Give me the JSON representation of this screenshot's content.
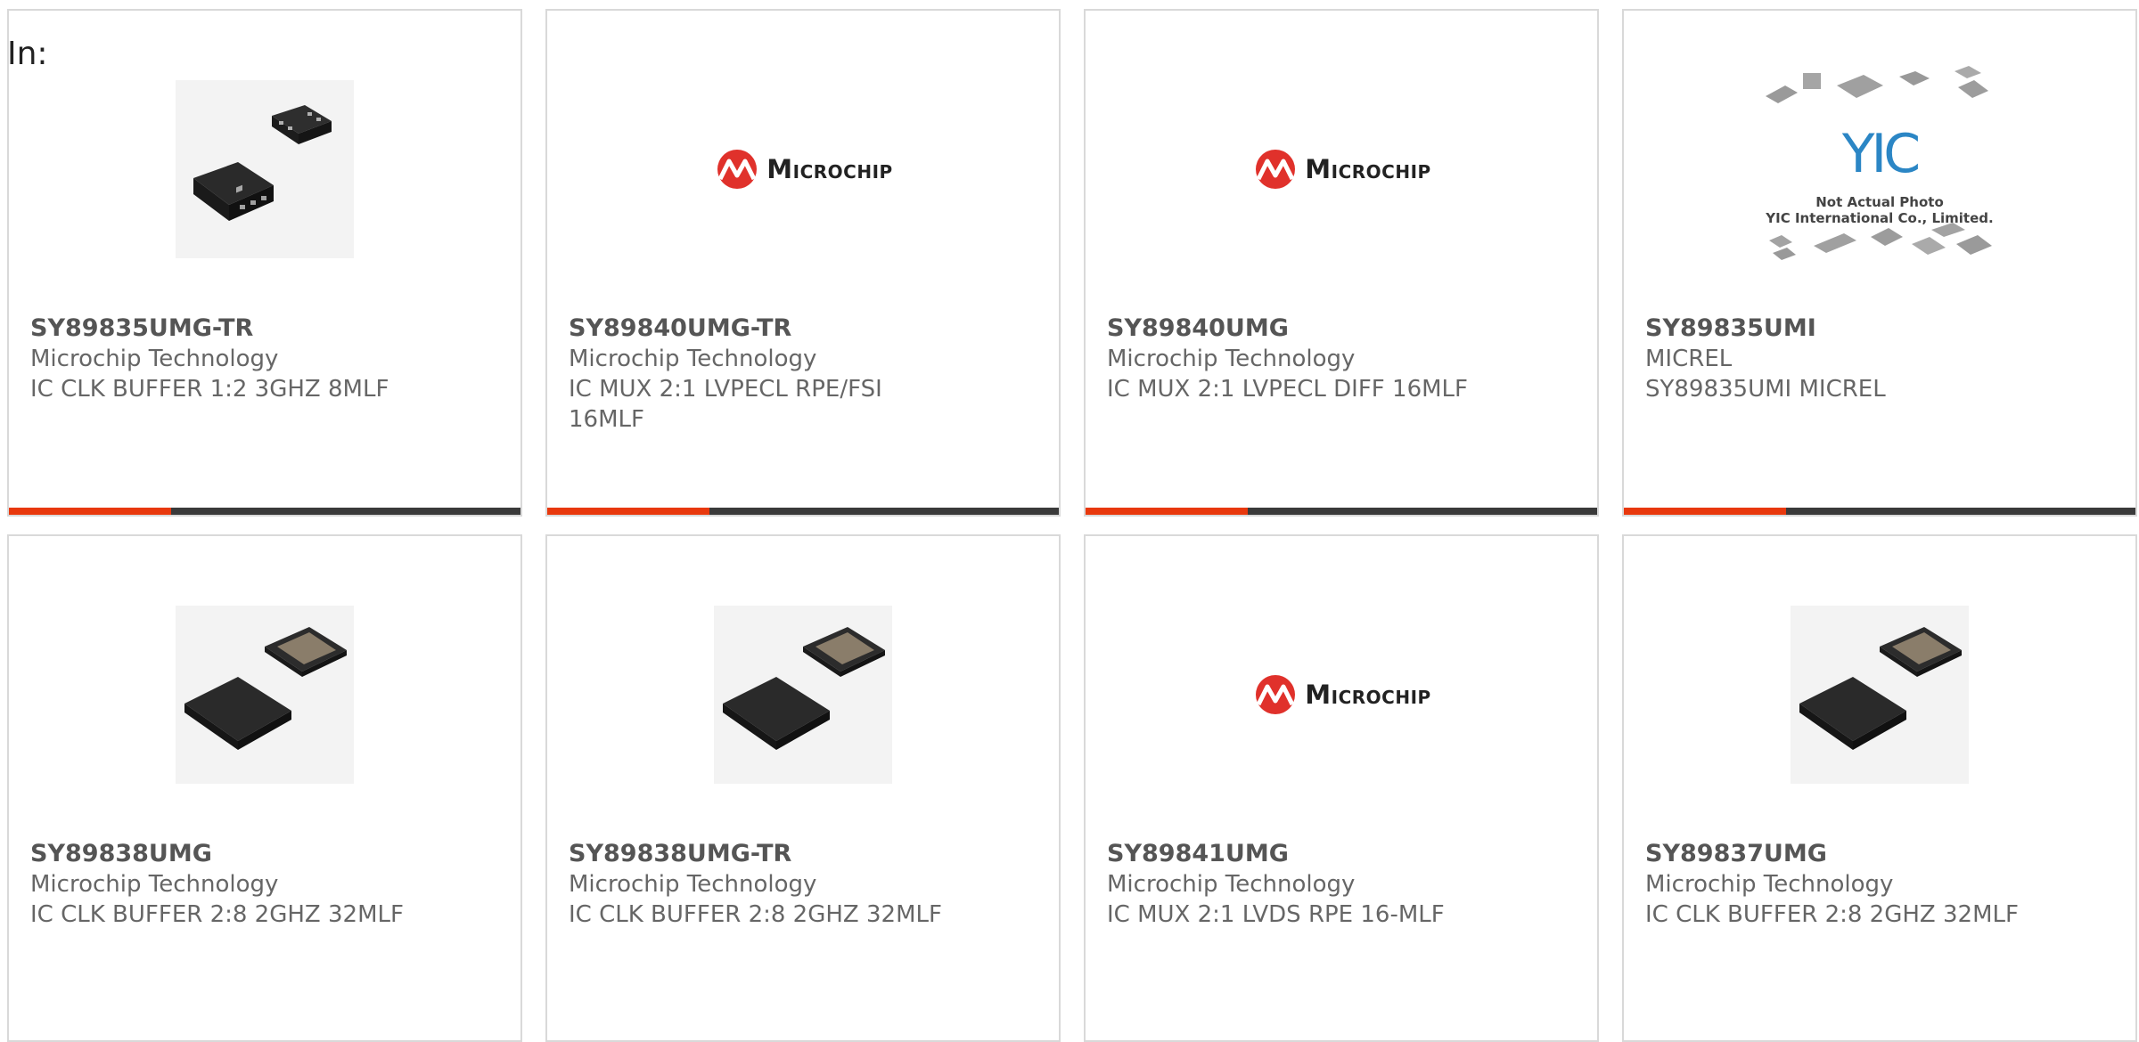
{
  "header": {
    "in_label": "In:"
  },
  "logo_text": "Microchip",
  "yic_image": {
    "line1": "Not Actual Photo",
    "line2": "YIC International Co., Limited.",
    "mark": "YIC"
  },
  "colors": {
    "accent": "#e8380d",
    "bar_dark": "#3a3a3a",
    "text": "#666666",
    "border": "#d9d9d9"
  },
  "products": [
    {
      "part": "SY89835UMG-TR",
      "manufacturer": "Microchip Technology",
      "description": "IC CLK BUFFER 1:2 3GHZ 8MLF",
      "image": "chip-8pin-photo"
    },
    {
      "part": "SY89840UMG-TR",
      "manufacturer": "Microchip Technology",
      "description": "IC MUX 2:1 LVPECL RPE/FSI 16MLF",
      "image": "microchip-logo"
    },
    {
      "part": "SY89840UMG",
      "manufacturer": "Microchip Technology",
      "description": "IC MUX 2:1 LVPECL DIFF 16MLF",
      "image": "microchip-logo"
    },
    {
      "part": "SY89835UMI",
      "manufacturer": "MICREL",
      "description": "SY89835UMI MICREL",
      "image": "yic-placeholder"
    },
    {
      "part": "SY89838UMG",
      "manufacturer": "Microchip Technology",
      "description": "IC CLK BUFFER 2:8 2GHZ 32MLF",
      "image": "chip-32pin-photo"
    },
    {
      "part": "SY89838UMG-TR",
      "manufacturer": "Microchip Technology",
      "description": "IC CLK BUFFER 2:8 2GHZ 32MLF",
      "image": "chip-32pin-photo"
    },
    {
      "part": "SY89841UMG",
      "manufacturer": "Microchip Technology",
      "description": "IC MUX 2:1 LVDS RPE 16-MLF",
      "image": "microchip-logo"
    },
    {
      "part": "SY89837UMG",
      "manufacturer": "Microchip Technology",
      "description": "IC CLK BUFFER 2:8 2GHZ 32MLF",
      "image": "chip-32pin-photo"
    }
  ]
}
